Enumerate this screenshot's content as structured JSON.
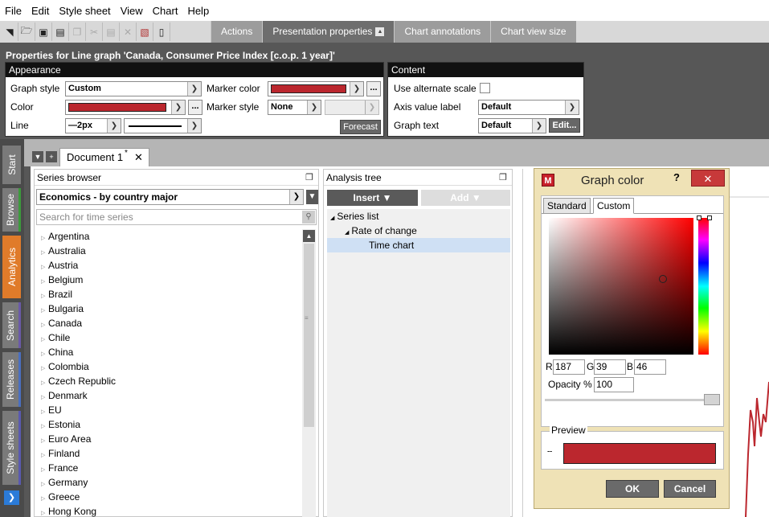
{
  "menu": [
    "File",
    "Edit",
    "Style sheet",
    "View",
    "Chart",
    "Help"
  ],
  "toolbar": {
    "icons": [
      "new-doc-icon",
      "open-folder-icon",
      "save-icon",
      "print-icon",
      "copy-icon",
      "cut-icon",
      "paste-icon",
      "delete-icon",
      "chart-series-icon",
      "document-icon"
    ],
    "tabs": [
      "Actions",
      "Presentation properties",
      "Chart annotations",
      "Chart view size"
    ],
    "active_tab": "Presentation properties"
  },
  "properties": {
    "title": "Properties for Line graph 'Canada, Consumer Price Index [c.o.p. 1 year]'",
    "appearance": {
      "header": "Appearance",
      "graph_style_label": "Graph style",
      "graph_style_value": "Custom",
      "color_label": "Color",
      "line_label": "Line",
      "line_width_value": "2px",
      "marker_color_label": "Marker color",
      "marker_style_label": "Marker style",
      "marker_style_value": "None",
      "forecast_label": "Forecast",
      "color_hex": "#bb272e"
    },
    "content": {
      "header": "Content",
      "alt_scale_label": "Use alternate scale",
      "axis_value_label": "Axis value label",
      "axis_value_value": "Default",
      "graph_text_label": "Graph text",
      "graph_text_value": "Default",
      "edit_label": "Edit..."
    }
  },
  "sidetabs": [
    "Start",
    "Browse",
    "Analytics",
    "Search",
    "Releases",
    "Style sheets"
  ],
  "sidetab_colors": [
    "#7a7a7a",
    "#3c9a3c",
    "#e07b2a",
    "#6a5aa8",
    "#4a6fc0",
    "#5a5ab0"
  ],
  "document": {
    "tab_label": "Document 1",
    "modified_mark": "*"
  },
  "series_browser": {
    "title": "Series browser",
    "database": "Economics - by country major",
    "search_placeholder": "Search for time series",
    "countries": [
      "Argentina",
      "Australia",
      "Austria",
      "Belgium",
      "Brazil",
      "Bulgaria",
      "Canada",
      "Chile",
      "China",
      "Colombia",
      "Czech Republic",
      "Denmark",
      "EU",
      "Estonia",
      "Euro Area",
      "Finland",
      "France",
      "Germany",
      "Greece",
      "Hong Kong"
    ]
  },
  "analysis_tree": {
    "title": "Analysis tree",
    "insert_label": "Insert",
    "add_label": "Add",
    "nodes": [
      "Series list",
      "Rate of change",
      "Time chart"
    ]
  },
  "dialog": {
    "title": "Graph color",
    "help": "?",
    "tabs": [
      "Standard",
      "Custom"
    ],
    "active_tab": "Custom",
    "r_label": "R",
    "g_label": "G",
    "b_label": "B",
    "r": "187",
    "g": "39",
    "b": "46",
    "opacity_label": "Opacity %",
    "opacity": "100",
    "preview_label": "Preview",
    "ok_label": "OK",
    "cancel_label": "Cancel",
    "preview_color": "#bb272e"
  }
}
